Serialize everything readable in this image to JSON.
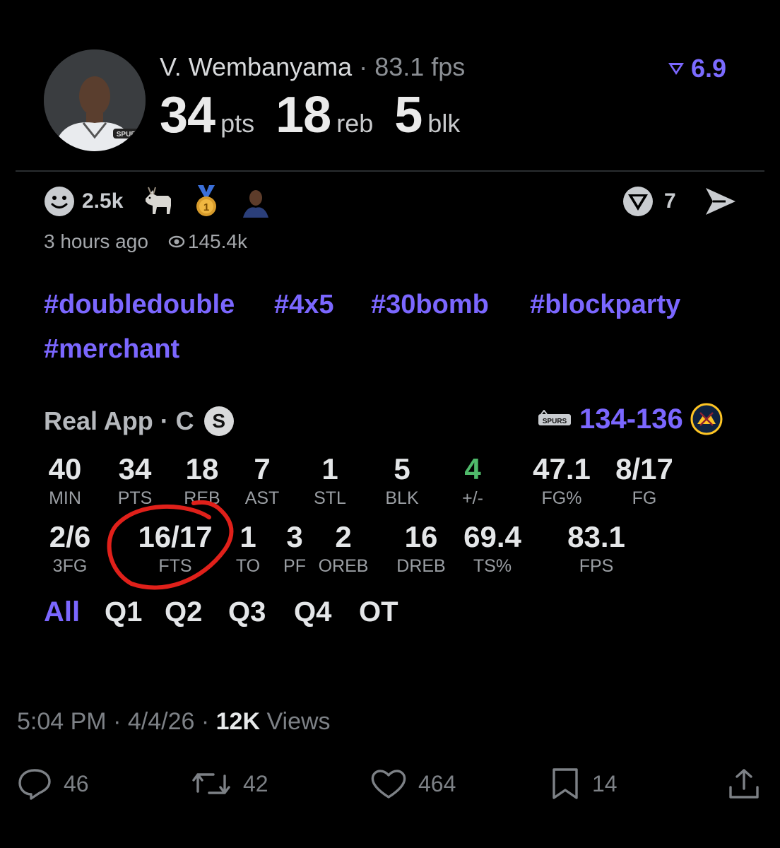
{
  "post": {
    "player_name": "V. Wembanyama",
    "separator": "·",
    "fps_label": "83.1 fps",
    "rating": "6.9",
    "pts": "34",
    "pts_unit": "pts",
    "reb": "18",
    "reb_unit": "reb",
    "blk": "5",
    "blk_unit": "blk",
    "avatar_team_text": "SPURS"
  },
  "reactions": {
    "smile_count": "2.5k",
    "share_count": "7",
    "time_ago": "3 hours ago",
    "views": "145.4k",
    "medal_number": "1"
  },
  "hashtags": [
    "#doubledouble",
    "#4x5",
    "#30bomb",
    "#blockparty",
    "#merchant"
  ],
  "game": {
    "app_label": "Real App · C",
    "badge": "S",
    "home_logo_text": "SPURS",
    "score": "134-136"
  },
  "stats_row1": [
    {
      "value": "40",
      "label": "MIN"
    },
    {
      "value": "34",
      "label": "PTS"
    },
    {
      "value": "18",
      "label": "REB"
    },
    {
      "value": "7",
      "label": "AST"
    },
    {
      "value": "1",
      "label": "STL"
    },
    {
      "value": "5",
      "label": "BLK"
    },
    {
      "value": "4",
      "label": "+/-"
    },
    {
      "value": "47.1",
      "label": "FG%"
    },
    {
      "value": "8/17",
      "label": "FG"
    }
  ],
  "stats_row2": [
    {
      "value": "2/6",
      "label": "3FG"
    },
    {
      "value": "16/17",
      "label": "FTS"
    },
    {
      "value": "1",
      "label": "TO"
    },
    {
      "value": "3",
      "label": "PF"
    },
    {
      "value": "2",
      "label": "OREB"
    },
    {
      "value": "16",
      "label": "DREB"
    },
    {
      "value": "69.4",
      "label": "TS%"
    },
    {
      "value": "83.1",
      "label": "FPS"
    }
  ],
  "periods": [
    "All",
    "Q1",
    "Q2",
    "Q3",
    "Q4",
    "OT"
  ],
  "active_period": "All",
  "tweet": {
    "time": "5:04 PM",
    "sep": "·",
    "date": "4/4/26",
    "views_count": "12K",
    "views_word": "Views",
    "replies": "46",
    "retweets": "42",
    "likes": "464",
    "bookmarks": "14"
  },
  "colors": {
    "accent": "#7b67ff",
    "positive": "#4fb96a",
    "annotation": "#e0201a",
    "background": "#000000"
  },
  "icons": [
    "verified-v-icon",
    "smile-icon",
    "goat-icon",
    "medal-icon",
    "player-avatar-icon",
    "shield-icon",
    "send-icon",
    "eye-icon",
    "nuggets-logo-icon",
    "spurs-logo-icon",
    "reply-icon",
    "retweet-icon",
    "like-icon",
    "bookmark-icon",
    "share-icon"
  ]
}
